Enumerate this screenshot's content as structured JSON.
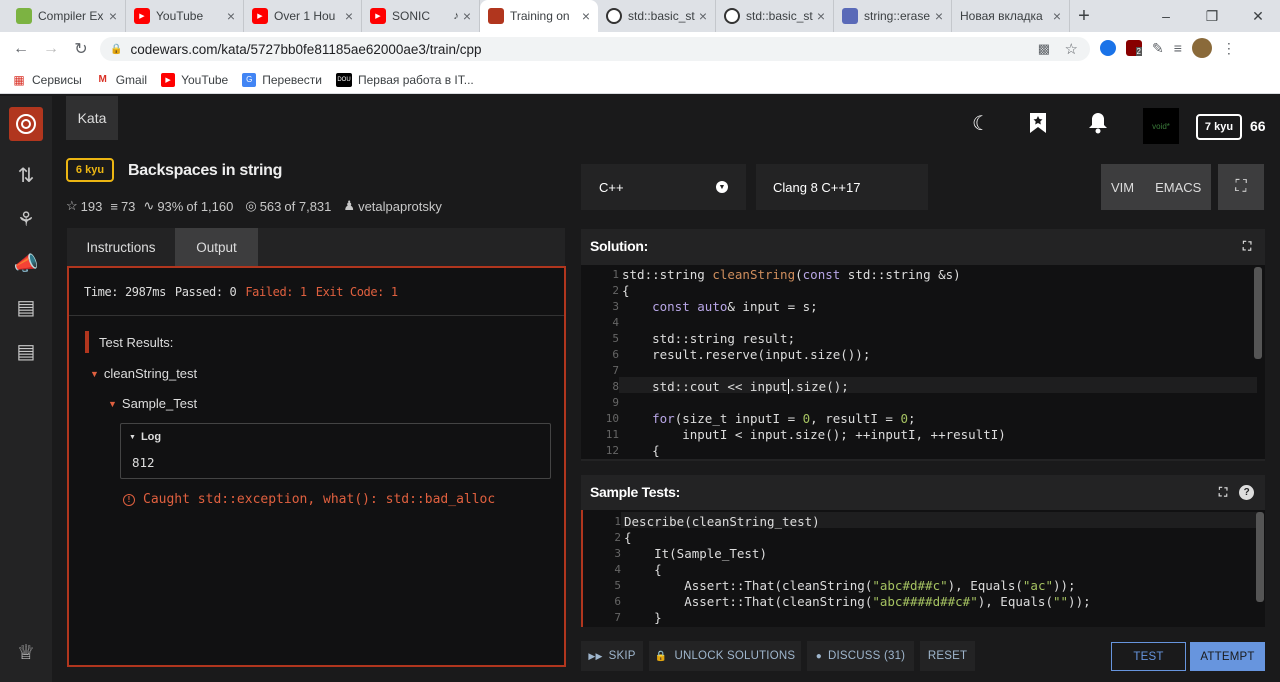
{
  "browser": {
    "tabs": [
      {
        "title": "Compiler Ex",
        "icon": "compiler-icon",
        "color": "#7cb342"
      },
      {
        "title": "YouTube",
        "icon": "youtube-icon",
        "color": "#ff0000"
      },
      {
        "title": "Over 1 Hou",
        "icon": "youtube-icon",
        "color": "#ff0000"
      },
      {
        "title": "SONIC",
        "icon": "youtube-icon",
        "color": "#ff0000"
      },
      {
        "title": "Training on",
        "icon": "codewars-icon",
        "color": "#b1361e"
      },
      {
        "title": "std::basic_st",
        "icon": "cppreference-icon",
        "color": "#333"
      },
      {
        "title": "std::basic_st",
        "icon": "cppreference-icon",
        "color": "#333"
      },
      {
        "title": "string::erase",
        "icon": "cplusplus-icon",
        "color": "#5a6ab8"
      },
      {
        "title": "Новая вкладка",
        "icon": "",
        "color": "#fff"
      }
    ],
    "url": "codewars.com/kata/5727bb0fe81185ae62000ae3/train/cpp",
    "bookmarks": [
      {
        "label": "Сервисы",
        "icon": "apps-icon"
      },
      {
        "label": "Gmail",
        "icon": "gmail-icon"
      },
      {
        "label": "YouTube",
        "icon": "youtube-icon"
      },
      {
        "label": "Перевести",
        "icon": "translate-icon"
      },
      {
        "label": "Первая работа в IT...",
        "icon": "dou-icon"
      }
    ],
    "extension_badge": "2"
  },
  "header": {
    "kata_tab": "Kata",
    "avatar_text": "void*",
    "rank": "7 kyu",
    "honor": "66"
  },
  "kata": {
    "rank": "6 kyu",
    "title": "Backspaces in string",
    "stars": "193",
    "collections": "73",
    "satisfaction": "93%",
    "satisfaction_of": "of 1,160",
    "completed": "563",
    "completed_of": "of 7,831",
    "author": "vetalpaprotsky"
  },
  "left_tabs": {
    "instructions": "Instructions",
    "output": "Output"
  },
  "output": {
    "time": "Time: 2987ms",
    "passed": "Passed: 0",
    "failed": "Failed: 1",
    "exit_code": "Exit Code: 1",
    "test_results_label": "Test Results:",
    "describe": "cleanString_test",
    "it": "Sample_Test",
    "log_label": "Log",
    "log_value": "812",
    "error": "Caught std::exception, what(): std::bad_alloc"
  },
  "editor_bar": {
    "language": "C++",
    "compiler": "Clang 8 C++17",
    "vim": "VIM",
    "emacs": "EMACS"
  },
  "solution": {
    "title": "Solution:",
    "line_numbers": [
      "1",
      "2",
      "3",
      "4",
      "5",
      "6",
      "7",
      "8",
      "9",
      "10",
      "11",
      "12"
    ]
  },
  "sample_tests": {
    "title": "Sample Tests:",
    "line_numbers": [
      "1",
      "2",
      "3",
      "4",
      "5",
      "6",
      "7"
    ]
  },
  "buttons": {
    "skip": "SKIP",
    "unlock": "UNLOCK SOLUTIONS",
    "discuss": "DISCUSS (31)",
    "reset": "RESET",
    "test": "TEST",
    "attempt": "ATTEMPT"
  }
}
